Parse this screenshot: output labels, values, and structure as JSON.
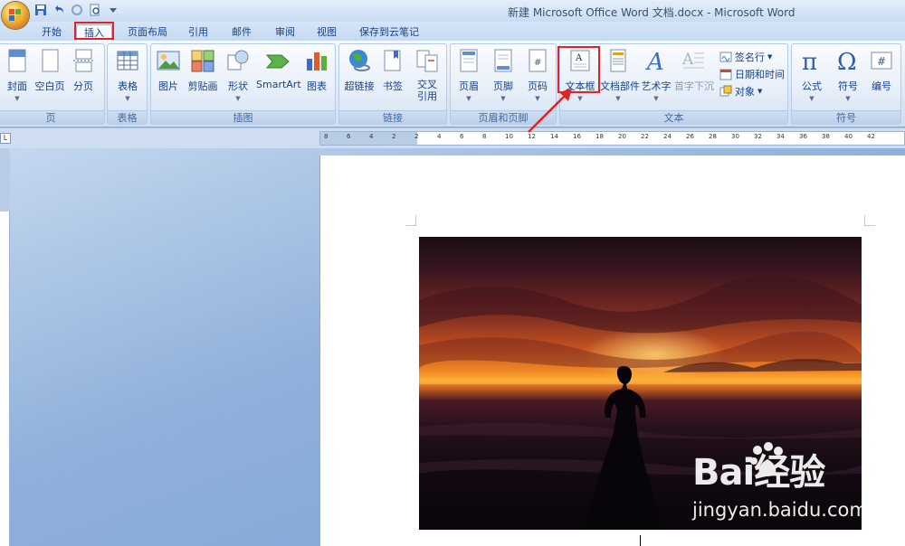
{
  "window": {
    "title": "新建 Microsoft Office Word 文档.docx - Microsoft Word"
  },
  "tabs": [
    {
      "label": "开始"
    },
    {
      "label": "插入"
    },
    {
      "label": "页面布局"
    },
    {
      "label": "引用"
    },
    {
      "label": "邮件"
    },
    {
      "label": "审阅"
    },
    {
      "label": "视图"
    },
    {
      "label": "保存到云笔记"
    }
  ],
  "ribbon": {
    "pages_group": {
      "label": "页",
      "cover": "封面",
      "blank": "空白页",
      "break": "分页"
    },
    "table_group": {
      "label": "表格",
      "table": "表格"
    },
    "illustrations_group": {
      "label": "插图",
      "picture": "图片",
      "clipart": "剪贴画",
      "shapes": "形状",
      "smartart": "SmartArt",
      "chart": "图表"
    },
    "links_group": {
      "label": "链接",
      "hyperlink": "超链接",
      "bookmark": "书签",
      "crossref": "交叉\n引用"
    },
    "header_footer_group": {
      "label": "页眉和页脚",
      "header": "页眉",
      "footer": "页脚",
      "page_number": "页码"
    },
    "text_group": {
      "label": "文本",
      "textbox": "文本框",
      "quickparts": "文档部件",
      "wordart": "艺术字",
      "dropcap": "首字下沉",
      "signature": "签名行",
      "datetime": "日期和时间",
      "object": "对象"
    },
    "symbols_group": {
      "label": "符号",
      "equation": "公式",
      "symbol": "符号",
      "number": "编号"
    }
  },
  "ruler": {
    "ticks": [
      "8",
      "6",
      "4",
      "2",
      "2",
      "4",
      "6",
      "8",
      "10",
      "12",
      "14",
      "16",
      "18",
      "20",
      "22",
      "24",
      "26",
      "28",
      "30",
      "32",
      "34",
      "36",
      "38",
      "40",
      "42"
    ]
  },
  "watermark": {
    "brand": "Bai经验",
    "url": "jingyan.baidu.com"
  },
  "colors": {
    "highlight": "#e02424",
    "ribbon_text": "#15428b"
  }
}
